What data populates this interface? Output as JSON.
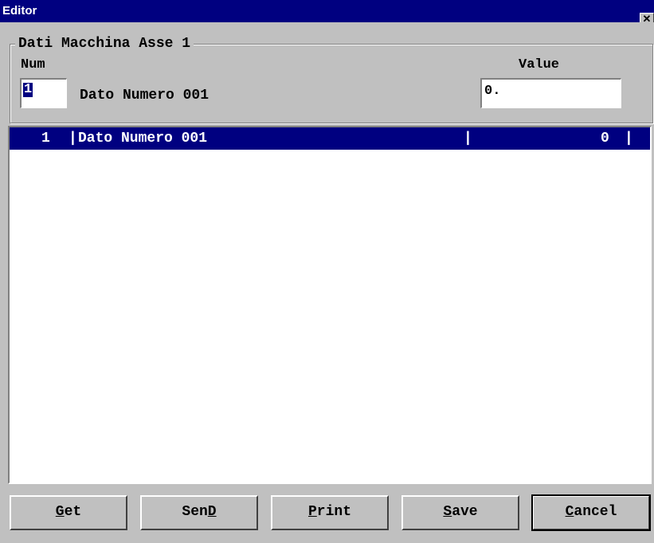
{
  "window": {
    "title": "Editor",
    "close_glyph": "✕"
  },
  "group": {
    "title": "Dati Macchina Asse 1",
    "num_label": "Num",
    "value_label": "Value",
    "num_value": "1",
    "description": "Dato Numero 001",
    "value_field": "0."
  },
  "list": {
    "rows": [
      {
        "num": "1",
        "sep": "|",
        "desc": "Dato Numero 001",
        "value": "0"
      }
    ]
  },
  "buttons": {
    "get": {
      "mnemonic": "G",
      "rest": "et"
    },
    "send": {
      "prefix": "Sen",
      "mnemonic": "D"
    },
    "print": {
      "mnemonic": "P",
      "rest": "rint"
    },
    "save": {
      "mnemonic": "S",
      "rest": "ave"
    },
    "cancel": {
      "mnemonic": "C",
      "rest": "ancel"
    }
  },
  "colors": {
    "title_bg": "#000080",
    "face": "#c0c0c0",
    "selection": "#000080"
  }
}
